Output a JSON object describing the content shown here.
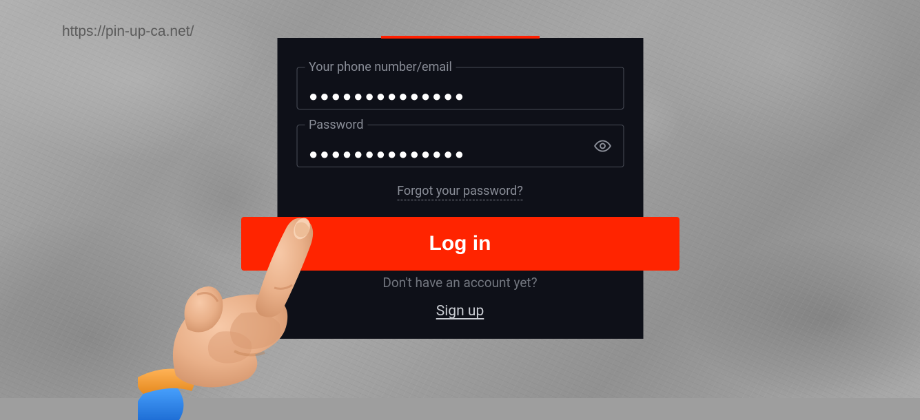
{
  "url_text": "https://pin-up-ca.net/",
  "form": {
    "username_label": "Your phone number/email",
    "username_value": "●●●●●●●●●●●●●●",
    "password_label": "Password",
    "password_value": "●●●●●●●●●●●●●●",
    "forgot_link": "Forgot your password?",
    "login_button": "Log in",
    "no_account_text": "Don't have an account yet?",
    "signup_link": "Sign up"
  }
}
